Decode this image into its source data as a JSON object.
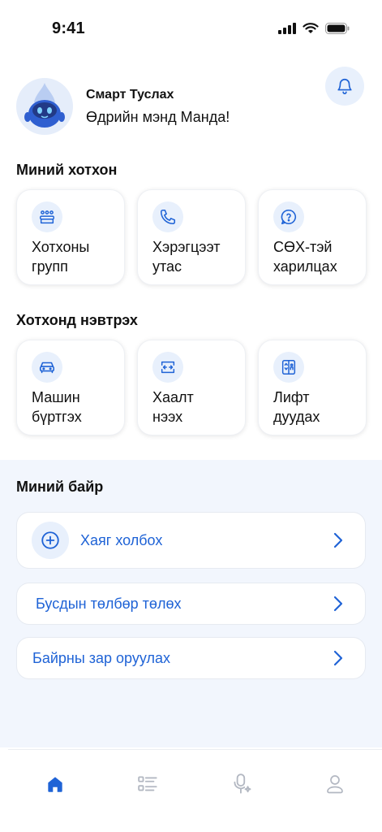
{
  "status_bar": {
    "time": "9:41"
  },
  "header": {
    "title": "Смарт Туслах",
    "greeting": "Өдрийн мэнд Манда!"
  },
  "my_complex": {
    "title": "Миний хотхон",
    "tiles": [
      {
        "label": "Хотхоны\nгрупп",
        "icon": "group-icon"
      },
      {
        "label": "Хэрэгцээт\nутас",
        "icon": "phone-icon"
      },
      {
        "label": "СӨХ-тэй\nхарилцах",
        "icon": "question-icon"
      }
    ]
  },
  "access": {
    "title": "Хотхонд нэвтрэх",
    "tiles": [
      {
        "label": "Машин\nбүртгэх",
        "icon": "car-icon"
      },
      {
        "label": "Хаалт\nнээх",
        "icon": "gate-icon"
      },
      {
        "label": "Лифт\nдуудах",
        "icon": "elevator-icon"
      }
    ]
  },
  "my_building": {
    "title": "Миний байр",
    "rows": [
      {
        "label": "Хаяг холбох"
      },
      {
        "label": "Бусдын төлбөр төлөх"
      },
      {
        "label": "Байрны зар оруулах"
      }
    ]
  },
  "tabbar": {
    "items": [
      {
        "icon": "home-icon",
        "active": true
      },
      {
        "icon": "list-icon",
        "active": false
      },
      {
        "icon": "assistant-mic-icon",
        "active": false
      },
      {
        "icon": "profile-icon",
        "active": false
      }
    ]
  },
  "colors": {
    "accent": "#1f63d6",
    "icon_bg": "#e8f0fc",
    "section_bg": "#f2f6fd"
  }
}
